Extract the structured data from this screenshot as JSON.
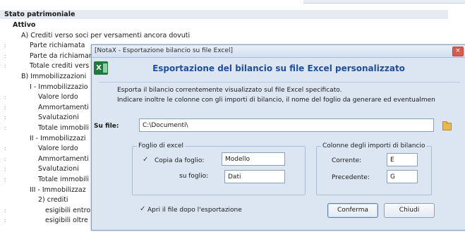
{
  "spreadsheet": {
    "section_title": "Stato patrimoniale",
    "rows": [
      {
        "text": "Attivo",
        "indent": 1,
        "bold": true,
        "gutter": ""
      },
      {
        "text": "A) Crediti verso soci per versamenti ancora dovuti",
        "indent": 2,
        "bold": false,
        "gutter": ""
      },
      {
        "text": "Parte richiamata",
        "indent": 3,
        "bold": false,
        "gutter": ":"
      },
      {
        "text": "Parte da richiamare",
        "indent": 3,
        "bold": false,
        "gutter": ":"
      },
      {
        "text": "Totale crediti vers",
        "indent": 3,
        "bold": false,
        "gutter": ":"
      },
      {
        "text": "B) Immobilizzazioni",
        "indent": 2,
        "bold": false,
        "gutter": ""
      },
      {
        "text": "I - Immobilizzazio",
        "indent": 3,
        "bold": false,
        "gutter": ""
      },
      {
        "text": "Valore lordo",
        "indent": 4,
        "bold": false,
        "gutter": ":"
      },
      {
        "text": "Ammortamenti",
        "indent": 4,
        "bold": false,
        "gutter": ":"
      },
      {
        "text": "Svalutazioni",
        "indent": 4,
        "bold": false,
        "gutter": ":"
      },
      {
        "text": "Totale immobili",
        "indent": 4,
        "bold": false,
        "gutter": ":"
      },
      {
        "text": "II - Immobilizzazi",
        "indent": 3,
        "bold": false,
        "gutter": ""
      },
      {
        "text": "Valore lordo",
        "indent": 4,
        "bold": false,
        "gutter": ":"
      },
      {
        "text": "Ammortamenti",
        "indent": 4,
        "bold": false,
        "gutter": ":"
      },
      {
        "text": "Svalutazioni",
        "indent": 4,
        "bold": false,
        "gutter": ":"
      },
      {
        "text": "Totale immobili",
        "indent": 4,
        "bold": false,
        "gutter": ":"
      },
      {
        "text": "III - Immobilizzaz",
        "indent": 3,
        "bold": false,
        "gutter": ""
      },
      {
        "text": "2) crediti",
        "indent": 4,
        "bold": false,
        "gutter": ""
      },
      {
        "text": "esigibili entro",
        "indent": 5,
        "bold": false,
        "gutter": ":"
      },
      {
        "text": "esigibili oltre",
        "indent": 5,
        "bold": false,
        "gutter": ":"
      }
    ]
  },
  "dialog": {
    "window_title": "[NotaX - Esportazione bilancio su file Excel]",
    "close_glyph": "×",
    "excel_icon_letter": "X",
    "heading": "Esportazione del bilancio su file Excel personalizzato",
    "description_line1": "Esporta il bilancio correntemente visualizzato sul file Excel specificato.",
    "description_line2": "Indicare inoltre le colonne con gli importi di bilancio, il nome del foglio da generare ed eventualmen",
    "file_label": "Su file:",
    "file_value": "C:\\Documenti\\",
    "sheet_group": {
      "title": "Foglio di excel",
      "copy_checkbox_checked": true,
      "copy_label": "Copia da foglio:",
      "copy_value": "Modello",
      "target_label": "su foglio:",
      "target_value": "Dati"
    },
    "columns_group": {
      "title": "Colonne degli importi di bilancio",
      "current_label": "Corrente:",
      "current_value": "E",
      "previous_label": "Precedente:",
      "previous_value": "G"
    },
    "open_checkbox_checked": true,
    "open_label": "Apri il file dopo l'esportazione",
    "confirm_button": "Conferma",
    "close_button": "Chiudi"
  },
  "colors": {
    "dialog_bg": "#dce6f3",
    "heading_blue": "#1f4f9a",
    "excel_green": "#1f7a3e",
    "close_red": "#d85b50"
  }
}
